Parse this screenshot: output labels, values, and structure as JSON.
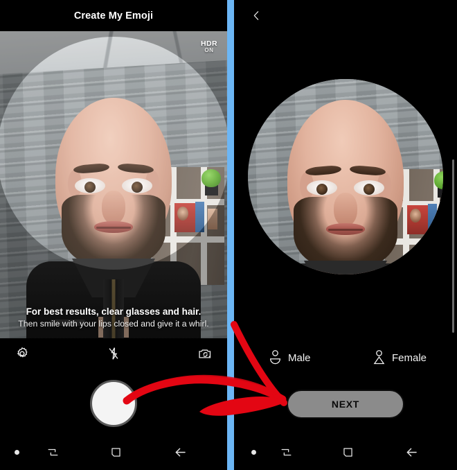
{
  "left_phone": {
    "header": {
      "title": "Create My Emoji"
    },
    "viewfinder": {
      "hdr_label": "HDR",
      "hdr_state": "ON",
      "tip_primary": "For best results, clear glasses and hair.",
      "tip_secondary": "Then smile with your lips closed and give it a whirl."
    },
    "controls": [
      {
        "name": "settings-button",
        "icon": "gear-icon"
      },
      {
        "name": "flash-off-button",
        "icon": "flash-off-icon"
      },
      {
        "name": "switch-camera-button",
        "icon": "camera-switch-icon"
      }
    ],
    "shutter": {
      "name": "shutter-button",
      "icon": "shutter-icon"
    }
  },
  "right_phone": {
    "header": {
      "back_icon": "chevron-left-icon"
    },
    "preview": {
      "name": "captured-photo-preview"
    },
    "gender_options": [
      {
        "label": "Male",
        "icon": "male-avatar-icon"
      },
      {
        "label": "Female",
        "icon": "female-avatar-icon"
      }
    ],
    "next_button": {
      "label": "NEXT"
    }
  },
  "nav_bar": {
    "items": [
      {
        "icon": "dot-icon"
      },
      {
        "icon": "recents-icon"
      },
      {
        "icon": "home-icon"
      },
      {
        "icon": "back-icon"
      }
    ]
  },
  "annotation": {
    "arrow": "red-curved-arrow"
  },
  "colors": {
    "divider_blue": "#6cb6f5",
    "annotation_red": "#e30613",
    "next_button_fill": "#8b8b8b",
    "background": "#000000"
  }
}
